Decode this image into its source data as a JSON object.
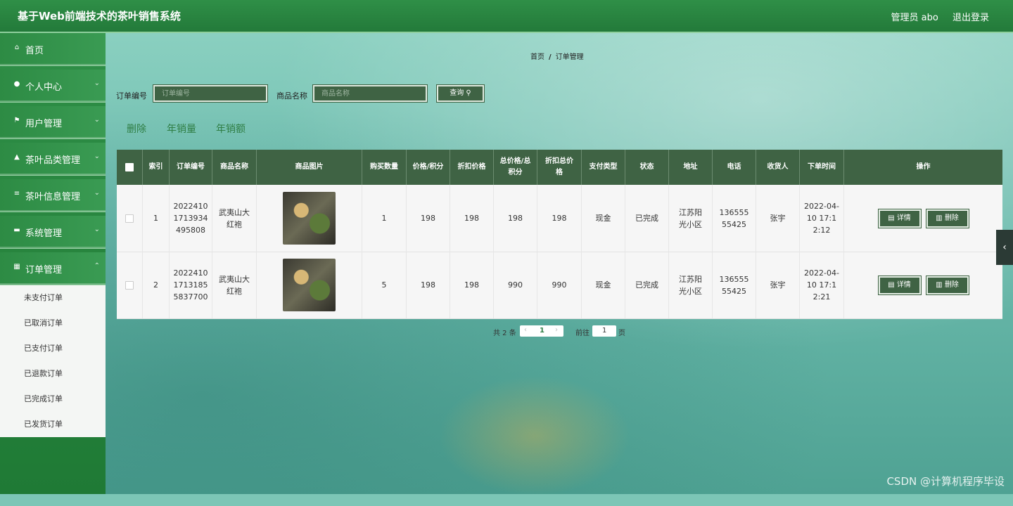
{
  "header": {
    "brand": "基于Web前端技术的茶叶销售系统",
    "user": "管理员 abo",
    "logout": "退出登录"
  },
  "sidebar": {
    "items": [
      {
        "label": "首页",
        "icon": "home-icon"
      },
      {
        "label": "个人中心",
        "icon": "user-icon"
      },
      {
        "label": "用户管理",
        "icon": "flag-icon"
      },
      {
        "label": "茶叶品类管理",
        "icon": "thumb-icon"
      },
      {
        "label": "茶叶信息管理",
        "icon": "list-icon"
      },
      {
        "label": "系统管理",
        "icon": "comment-icon"
      },
      {
        "label": "订单管理",
        "icon": "grid-icon"
      }
    ],
    "submenu": [
      "未支付订单",
      "已取消订单",
      "已支付订单",
      "已退款订单",
      "已完成订单",
      "已发货订单"
    ]
  },
  "breadcrumb": {
    "home": "首页",
    "sep": "/",
    "current": "订单管理"
  },
  "search": {
    "order_no_label": "订单编号",
    "order_no_placeholder": "订单编号",
    "product_label": "商品名称",
    "product_placeholder": "商品名称",
    "query_label": "查询"
  },
  "actions": {
    "delete": "删除",
    "annual_qty": "年销量",
    "annual_amount": "年销额"
  },
  "table": {
    "headers": [
      "索引",
      "订单编号",
      "商品名称",
      "商品图片",
      "购买数量",
      "价格/积分",
      "折扣价格",
      "总价格/总积分",
      "折扣总价格",
      "支付类型",
      "状态",
      "地址",
      "电话",
      "收货人",
      "下单时间",
      "操作"
    ],
    "rows": [
      {
        "index": "1",
        "order_no": "2022410171393449580​8",
        "product": "武夷山大红袍",
        "qty": "1",
        "price": "198",
        "discount_price": "198",
        "total": "198",
        "discount_total": "198",
        "pay_type": "现金",
        "status": "已完成",
        "address": "江苏阳光小区",
        "phone": "13655555425",
        "receiver": "张宇",
        "time": "2022-04-10 17:12:12"
      },
      {
        "index": "2",
        "order_no": "20224101713185583770​0",
        "product": "武夷山大红袍",
        "qty": "5",
        "price": "198",
        "discount_price": "198",
        "total": "990",
        "discount_total": "990",
        "pay_type": "现金",
        "status": "已完成",
        "address": "江苏阳光小区",
        "phone": "13655555425",
        "receiver": "张宇",
        "time": "2022-04-10 17:12:21"
      }
    ],
    "detail_label": "详情",
    "delete_label": "删除"
  },
  "pagination": {
    "total": "共 2 条",
    "page": "1",
    "goto": "前往",
    "goto_value": "1",
    "page_suffix": "页"
  },
  "watermark": "CSDN @计算机程序毕设"
}
